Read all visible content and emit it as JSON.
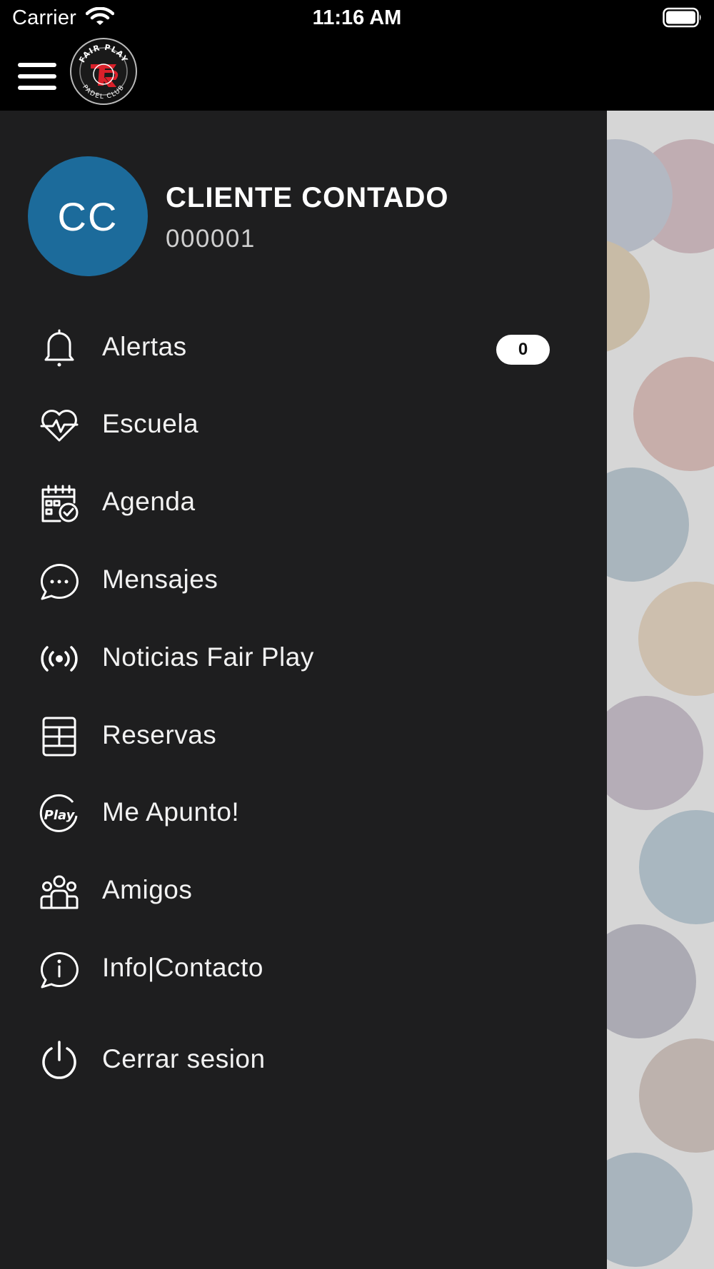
{
  "status_bar": {
    "carrier": "Carrier",
    "time": "11:16 AM",
    "wifi_icon": "wifi-icon",
    "battery_icon": "battery-icon"
  },
  "header": {
    "menu_icon": "hamburger-menu-icon",
    "logo_icon": "fair-play-padel-club-logo",
    "logo_text_top": "FAIR PLAY",
    "logo_text_bottom": "PADEL CLUB"
  },
  "profile": {
    "initials": "CC",
    "name": "CLIENTE CONTADO",
    "code": "000001",
    "avatar_color": "#1c6b9b"
  },
  "menu": {
    "items": [
      {
        "label": "Alertas",
        "icon": "bell-icon",
        "badge": "0"
      },
      {
        "label": "Escuela",
        "icon": "heart-pulse-icon"
      },
      {
        "label": "Agenda",
        "icon": "calendar-check-icon"
      },
      {
        "label": "Mensajes",
        "icon": "chat-bubble-icon"
      },
      {
        "label": "Noticias Fair Play",
        "icon": "broadcast-icon"
      },
      {
        "label": "Reservas",
        "icon": "court-icon"
      },
      {
        "label": "Me Apunto!",
        "icon": "play-icon"
      },
      {
        "label": "Amigos",
        "icon": "group-icon"
      },
      {
        "label": "Info|Contacto",
        "icon": "info-chat-icon"
      },
      {
        "label": "Cerrar sesion",
        "icon": "power-icon"
      }
    ]
  },
  "colors": {
    "drawer_bg": "#1e1e1f",
    "header_bg": "#000000",
    "backdrop_bg": "#d6d6d6",
    "logo_accent": "#d9202a"
  }
}
